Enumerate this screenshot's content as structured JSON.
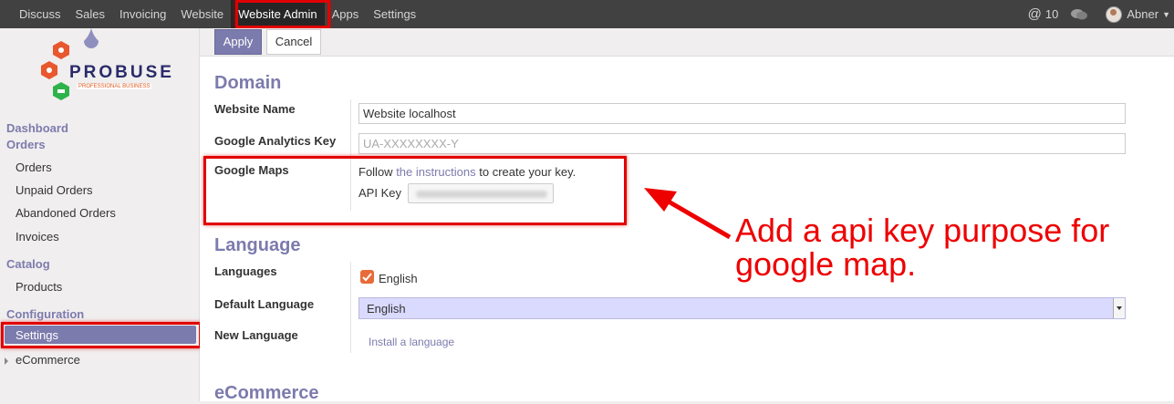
{
  "topbar": {
    "menu": [
      "Discuss",
      "Sales",
      "Invoicing",
      "Website",
      "Website Admin",
      "Apps",
      "Settings"
    ],
    "notifications_count": "10",
    "user_name": "Abner"
  },
  "sidebar": {
    "logo_text": "PROBUSE",
    "logo_subtext": "PROFESSIONAL BUSINESS",
    "dashboard": "Dashboard",
    "orders_heading": "Orders",
    "orders_items": [
      "Orders",
      "Unpaid Orders",
      "Abandoned Orders",
      "Invoices"
    ],
    "catalog_heading": "Catalog",
    "catalog_items": [
      "Products"
    ],
    "configuration_heading": "Configuration",
    "configuration_items": [
      "Settings",
      "eCommerce"
    ]
  },
  "actions": {
    "apply": "Apply",
    "cancel": "Cancel"
  },
  "domain": {
    "title": "Domain",
    "website_name_label": "Website Name",
    "website_name_value": "Website localhost",
    "analytics_label": "Google Analytics Key",
    "analytics_placeholder": "UA-XXXXXXXX-Y",
    "maps_label": "Google Maps",
    "maps_text_before": "Follow ",
    "maps_link": "the instructions",
    "maps_text_after": " to create your key.",
    "api_key_label": "API Key"
  },
  "language": {
    "title": "Language",
    "languages_label": "Languages",
    "languages_checked": "English",
    "default_label": "Default Language",
    "default_value": "English",
    "new_label": "New Language",
    "install_link": "Install a language"
  },
  "ecommerce": {
    "title": "eCommerce"
  },
  "annotation": {
    "text": "Add a api key purpose for google map."
  },
  "colors": {
    "accent": "#7c7bad",
    "highlight": "#e10000",
    "checkbox": "#e86b38"
  }
}
